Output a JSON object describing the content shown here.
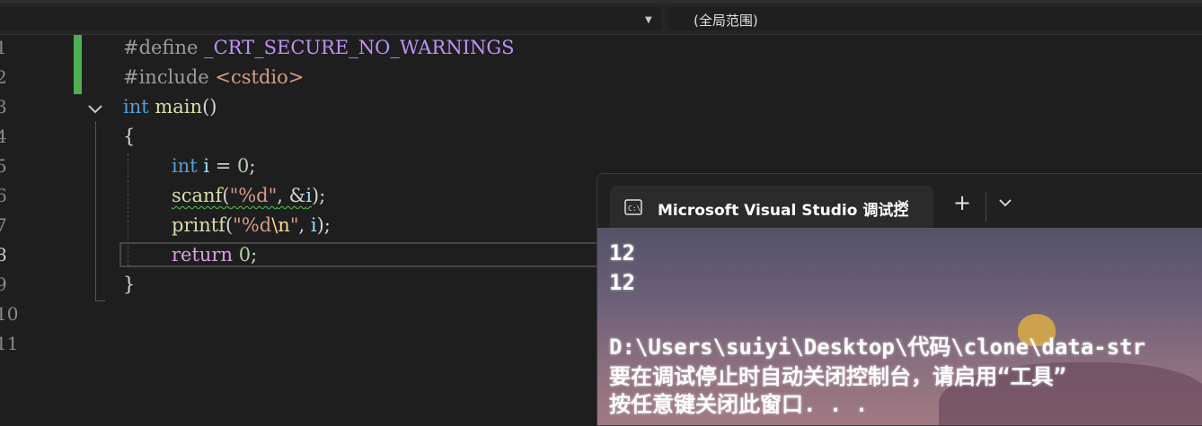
{
  "nav": {
    "scope": "(全局范围)"
  },
  "gutter": {
    "line_numbers": [
      "1",
      "2",
      "3",
      "4",
      "5",
      "6",
      "7",
      "8",
      "9",
      "10",
      "11"
    ],
    "active_line": "8"
  },
  "code": {
    "l1": {
      "kw": "#define ",
      "macro": "_CRT_SECURE_NO_WARNINGS"
    },
    "l2": {
      "kw": "#include ",
      "header": "<cstdio>"
    },
    "l3": {
      "type": "int",
      "sp": " ",
      "fn": "main",
      "rest": "()"
    },
    "l4": {
      "text": "{"
    },
    "l5": {
      "type": "int",
      "sp": " ",
      "var": "i",
      "op": " = ",
      "num": "0",
      "end": ";"
    },
    "l6": {
      "fn": "scanf",
      "p1": "(",
      "str": "\"%d\"",
      "p2": ", &",
      "var": "i",
      "p3": ");"
    },
    "l7": {
      "fn": "printf",
      "p1": "(",
      "str1": "\"%d",
      "esc": "\\n",
      "str2": "\"",
      "p2": ", ",
      "var": "i",
      "p3": ");"
    },
    "l8": {
      "kw": "return",
      "sp": " ",
      "num": "0",
      "end": ";"
    },
    "l9": {
      "text": "}"
    }
  },
  "terminal": {
    "tab_title": "Microsoft Visual Studio 调试控",
    "icon": "console-icon",
    "lines": [
      "12",
      "12",
      "",
      "D:\\Users\\suiyi\\Desktop\\代码\\clone\\data-str",
      "要在调试停止时自动关闭控制台，请启用“工具”",
      "按任意键关闭此窗口. . ."
    ]
  },
  "colors": {
    "change_bar": "#4caf50",
    "keyword": "#569cd6",
    "function": "#dcdcaa",
    "string": "#d69d85",
    "macro": "#bd93f9"
  }
}
